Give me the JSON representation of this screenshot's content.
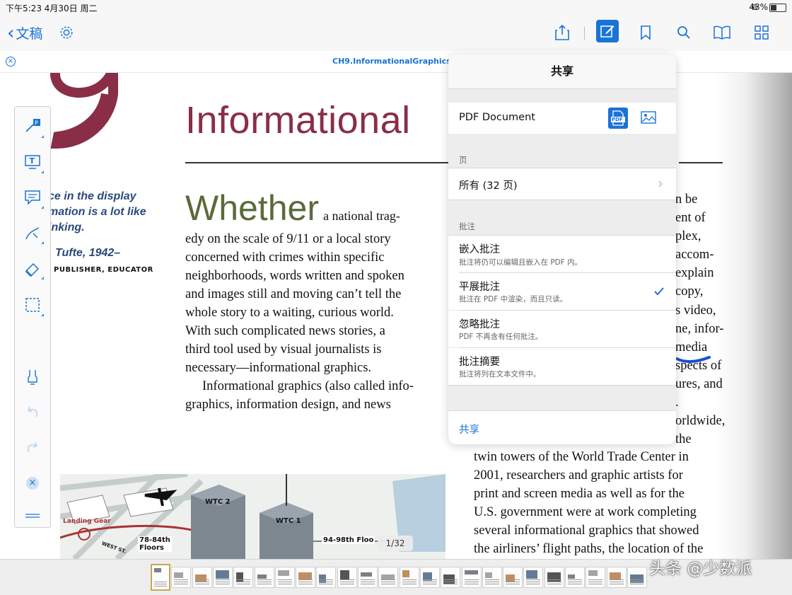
{
  "status": {
    "time_date": "下午5:23   4月30日 周二",
    "battery_percent": "43%"
  },
  "nav": {
    "back_label": "文稿"
  },
  "doc": {
    "filename": "CH9.InformationalGraphics"
  },
  "page": {
    "chapter_title": "Informational",
    "quote_lines": [
      "ce in the display",
      "mation is a lot like",
      "inking."
    ],
    "quote_author": "Tufte, 1942–",
    "quote_role": "PUBLISHER, EDUCATOR",
    "dropcap_word": "Whether",
    "left_col_first": "a national trag-",
    "left_col_lines": [
      "edy on the scale of 9/11 or a local story",
      "concerned with crimes within specific",
      "neighborhoods, words written and spoken",
      "and images still and moving can’t tell the",
      "whole story to a waiting, curious world.",
      "With such complicated news stories, a",
      "third tool used by visual journalists is",
      "necessary—informational graphics.",
      "Informational graphics (also called info-",
      "graphics, information design, and news"
    ],
    "right_col_fragments": [
      "n be",
      "ent of",
      "plex,",
      "accom-",
      "explain",
      "copy,",
      "s video,",
      "ne, infor-",
      "media",
      "spects of",
      "ures, and",
      ".",
      "orldwide,",
      "the"
    ],
    "right_col_lines": [
      "twin towers of the World Trade Center in",
      "2001, researchers and graphic artists for",
      "print and screen media as well as for the",
      "U.S. government were at work completing",
      "several informational graphics that showed",
      "the airliners’ flight paths, the location of the"
    ],
    "graphic_labels": {
      "wtc2": "WTC 2",
      "wtc1": "WTC 1",
      "landing_gear": "Landing Gear",
      "floors_a": "78-84th",
      "floors_b": "Floors",
      "floors_c": "94-98th Floo",
      "street": "WEST ST."
    },
    "page_indicator": "1/32"
  },
  "share": {
    "title": "共享",
    "format_label": "PDF Document",
    "pdf_badge": "PDF",
    "pages_header": "页",
    "pages_value": "所有 (32 页)",
    "annotations_header": "批注",
    "options": [
      {
        "title": "嵌入批注",
        "desc": "批注将仍可以编辑且嵌入在 PDF 内。",
        "selected": false
      },
      {
        "title": "平展批注",
        "desc": "批注在 PDF 中渲染，而且只读。",
        "selected": true
      },
      {
        "title": "忽略批注",
        "desc": "PDF 不再含有任何批注。",
        "selected": false
      },
      {
        "title": "批注摘要",
        "desc": "批注将列在文本文件中。",
        "selected": false
      }
    ],
    "share_button": "共享"
  },
  "watermark": "头条 @少数派",
  "colors": {
    "accent": "#1a73d6",
    "title_red": "#8a2e48",
    "dropcap_green": "#5a6b3a"
  }
}
